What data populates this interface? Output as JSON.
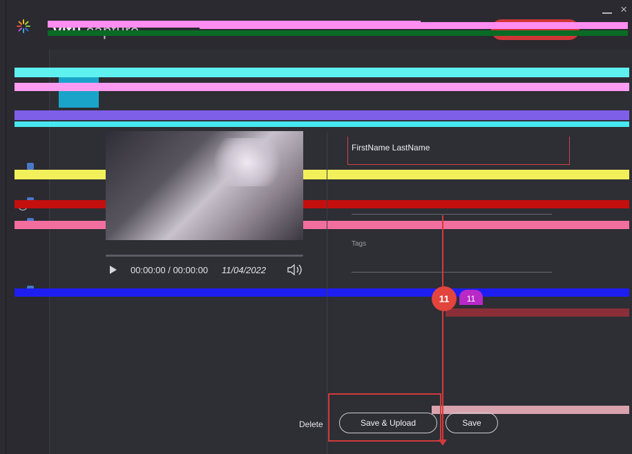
{
  "app": {
    "brand_prefix": "vitu",
    "brand_suffix": "capture"
  },
  "window": {
    "minimize_label": "–",
    "close_label": "×"
  },
  "player": {
    "time": "00:00:00 / 00:00:00",
    "date": "11/04/2022"
  },
  "fields": {
    "name_value": "FirstName LastName",
    "tags_label": "Tags"
  },
  "badges": {
    "red_count": "11",
    "purple_count": "11"
  },
  "actions": {
    "delete": "Delete",
    "save_upload": "Save & Upload",
    "save": "Save"
  },
  "colors": {
    "accent_red": "#d43a3a",
    "selection_blue": "#1ba4c9",
    "badge_red": "#e3443d",
    "badge_purple": "#b829c6"
  }
}
